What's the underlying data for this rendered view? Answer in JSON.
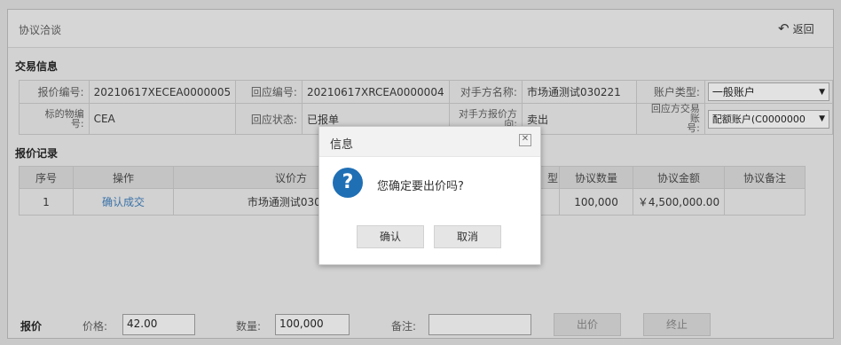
{
  "header": {
    "title": "协议洽谈",
    "back_icon": "undo-arrow-icon",
    "back_label": "返回"
  },
  "trade_info": {
    "section_title": "交易信息",
    "quote_no_label": "报价编号:",
    "quote_no": "20210617XECEA0000005",
    "response_no_label": "回应编号:",
    "response_no": "20210617XRCEA0000004",
    "counterparty_label": "对手方名称:",
    "counterparty": "市场通测试030221",
    "account_type_label": "账户类型:",
    "account_type": "一般账户",
    "subject_label_1": "标的物编",
    "subject_label_2": "号:",
    "subject": "CEA",
    "response_status_label": "回应状态:",
    "response_status": "已报单",
    "cp_quote_dir_label_1": "对手方报价方",
    "cp_quote_dir_label_2": "向:",
    "cp_quote_dir": "卖出",
    "resp_account_label_1": "回应方交易账",
    "resp_account_label_2": "号:",
    "resp_account": "配额账户(C0000000"
  },
  "records": {
    "section_title": "报价记录",
    "columns": [
      "序号",
      "操作",
      "议价方",
      "型",
      "协议数量",
      "协议金额",
      "协议备注"
    ],
    "rows": [
      {
        "seq": "1",
        "action": "确认成交",
        "party": "市场通测试03022",
        "type": "",
        "qty": "100,000",
        "amount": "￥4,500,000.00",
        "note": ""
      }
    ]
  },
  "footer": {
    "label": "报价",
    "price_label": "价格:",
    "price_value": "42.00",
    "qty_label": "数量:",
    "qty_value": "100,000",
    "note_label": "备注:",
    "note_value": "",
    "offer_button": "出价",
    "terminate_button": "终止"
  },
  "dialog": {
    "title": "信息",
    "close_icon": "close-icon",
    "icon": "question-icon",
    "message": "您确定要出价吗?",
    "confirm": "确认",
    "cancel": "取消"
  },
  "colors": {
    "link": "#3a72a8",
    "question_icon": "#1f6fb5",
    "overlay": "#c9c9c9"
  }
}
